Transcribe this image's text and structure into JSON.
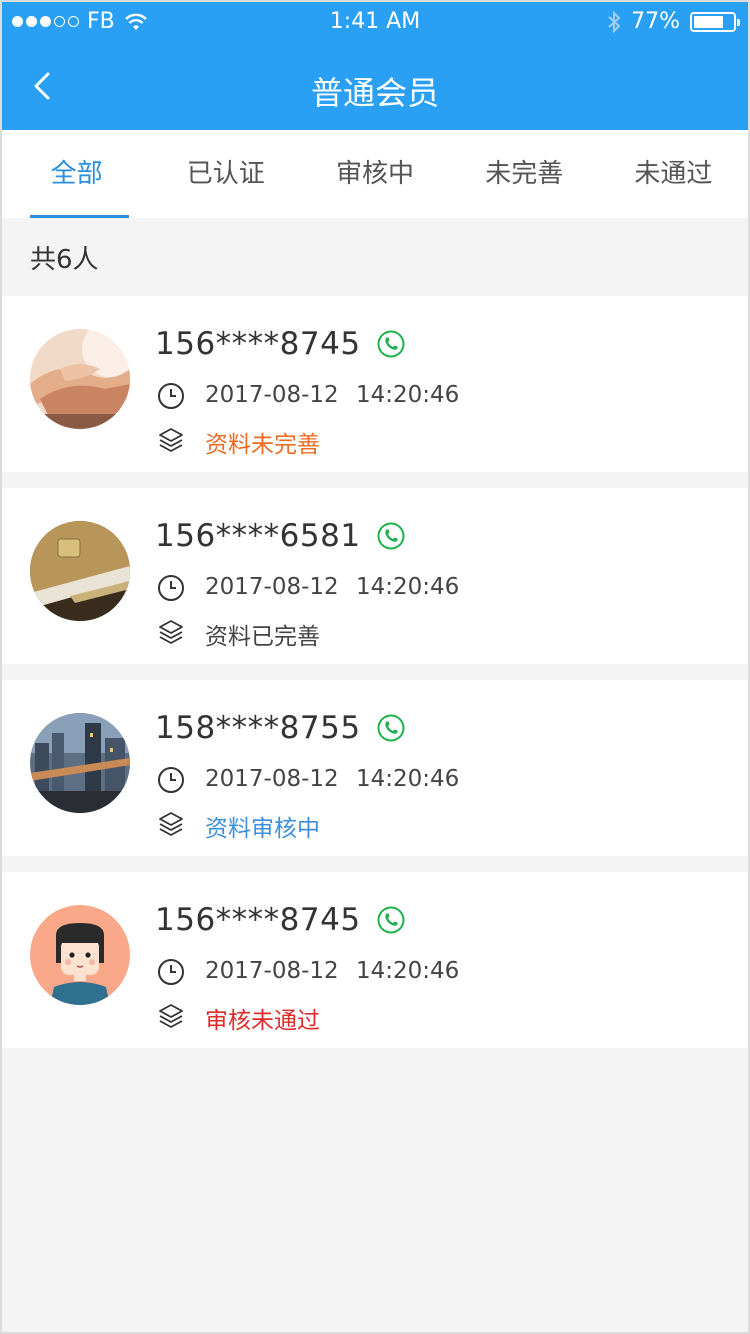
{
  "status_bar": {
    "carrier": "FB",
    "time": "1:41 AM",
    "battery": "77%",
    "battery_level": 0.77
  },
  "nav": {
    "title": "普通会员"
  },
  "tabs": [
    {
      "label": "全部",
      "active": true
    },
    {
      "label": "已认证",
      "active": false
    },
    {
      "label": "审核中",
      "active": false
    },
    {
      "label": "未完善",
      "active": false
    },
    {
      "label": "未通过",
      "active": false
    }
  ],
  "summary": {
    "count_text": "共6人"
  },
  "members": [
    {
      "phone": "156****8745",
      "datetime": "2017-08-12 14:20:46",
      "status": "资料未完善",
      "status_color": "#f06a1f",
      "avatar": "hands-photo"
    },
    {
      "phone": "156****6581",
      "datetime": "2017-08-12 14:20:46",
      "status": "资料已完善",
      "status_color": "#444444",
      "avatar": "bank-cards-photo"
    },
    {
      "phone": "158****8755",
      "datetime": "2017-08-12 14:20:46",
      "status": "资料审核中",
      "status_color": "#3d8fe0",
      "avatar": "city-skyline-photo"
    },
    {
      "phone": "156****8745",
      "datetime": "2017-08-12 14:20:46",
      "status": "审核未通过",
      "status_color": "#e12b2b",
      "avatar": "cartoon-girl"
    }
  ],
  "colors": {
    "primary": "#2aa0f5",
    "tab_active": "#2a8fde",
    "call_icon": "#1fb24a"
  }
}
